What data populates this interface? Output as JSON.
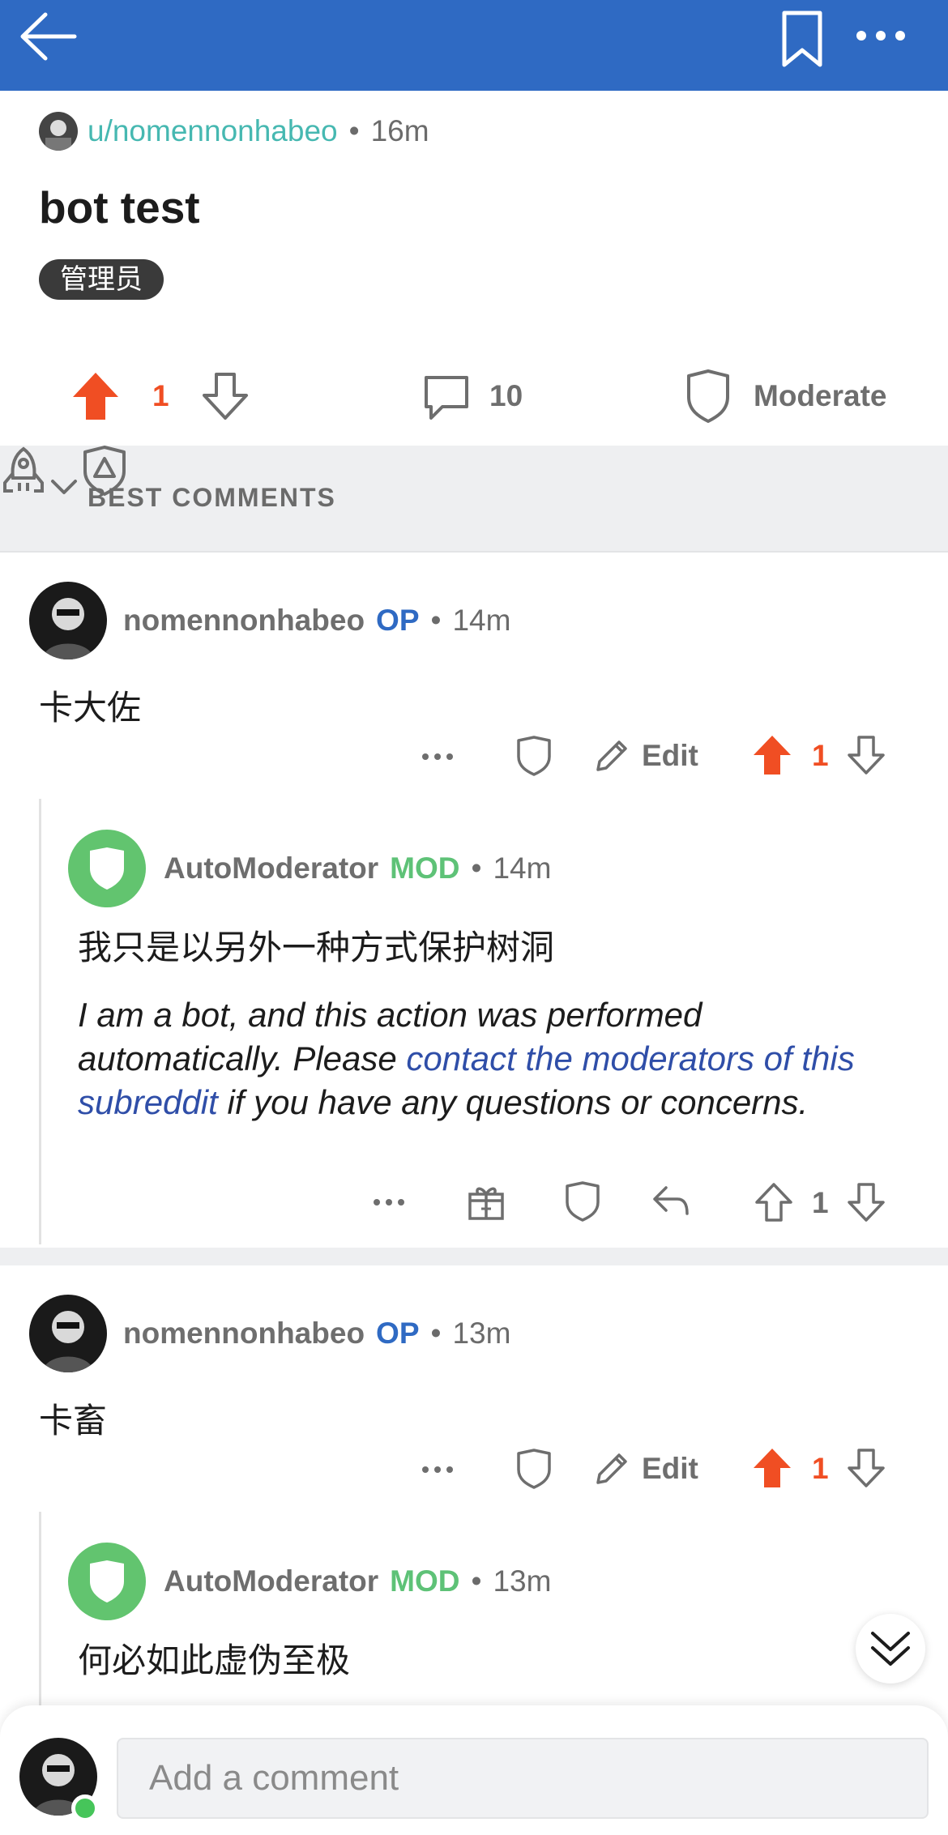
{
  "post": {
    "author": "u/nomennonhabeo",
    "age": "16m",
    "title": "bot test",
    "flair": "管理员",
    "votes": "1",
    "comments": "10",
    "moderate_label": "Moderate"
  },
  "sort": {
    "label": "BEST COMMENTS"
  },
  "comments": [
    {
      "author": "nomennonhabeo",
      "badge": "OP",
      "age": "14m",
      "body": "卡大佐",
      "edit_label": "Edit",
      "votes": "1",
      "reply": {
        "author": "AutoModerator",
        "badge": "MOD",
        "age": "14m",
        "body": "我只是以另外一种方式保护树洞",
        "bot_text_1": "I am a bot, and this action was performed automatically. Please ",
        "bot_link": "contact the moderators of this subreddit",
        "bot_text_2": " if you have any questions or concerns.",
        "votes": "1"
      }
    },
    {
      "author": "nomennonhabeo",
      "badge": "OP",
      "age": "13m",
      "body": "卡畜",
      "edit_label": "Edit",
      "votes": "1",
      "reply": {
        "author": "AutoModerator",
        "badge": "MOD",
        "age": "13m",
        "body": "何必如此虚伪至极"
      }
    }
  ],
  "composer": {
    "placeholder": "Add a comment"
  },
  "colors": {
    "brand": "#2f6ac3",
    "upvote": "#f04e23",
    "mod": "#5ec277",
    "op": "#2f6ac3"
  }
}
